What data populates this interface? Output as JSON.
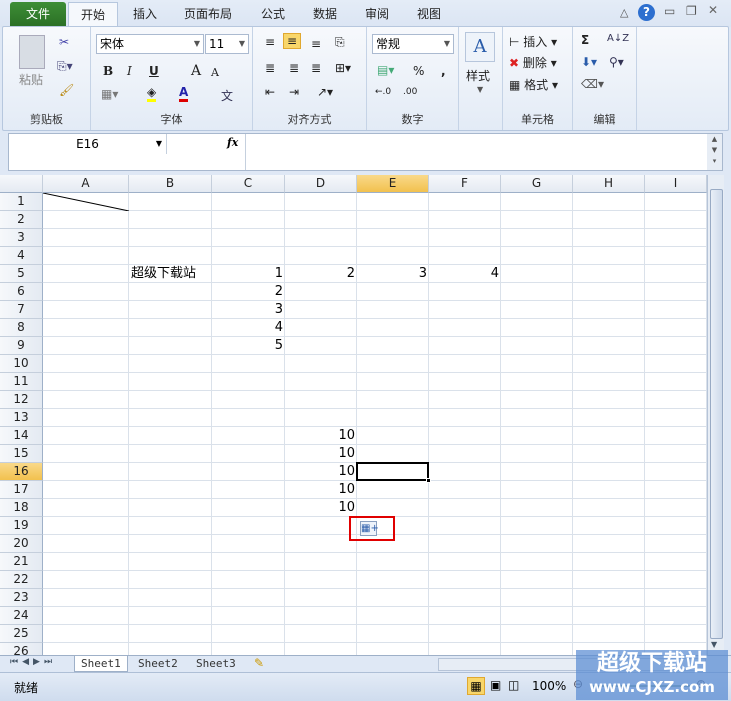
{
  "tabs": [
    "文件",
    "开始",
    "插入",
    "页面布局",
    "公式",
    "数据",
    "审阅",
    "视图"
  ],
  "ribbon": {
    "clipboard": {
      "paste": "粘贴",
      "label": "剪贴板"
    },
    "font": {
      "name": "宋体",
      "size": "11",
      "bold": "B",
      "italic": "I",
      "underline": "U",
      "grow": "A",
      "shrink": "A",
      "color": "A",
      "phonetic": "文",
      "label": "字体"
    },
    "align": {
      "label": "对齐方式"
    },
    "number": {
      "format": "常规",
      "percent": "%",
      "comma": ",",
      "inc": "←.0",
      "dec": ".00",
      "label": "数字"
    },
    "styles": {
      "label": "样式"
    },
    "cells": {
      "insert": "插入",
      "delete": "删除",
      "format": "格式",
      "label": "单元格"
    },
    "edit": {
      "sum": "Σ",
      "sort": "A↓Z",
      "label": "编辑"
    }
  },
  "formula_bar": {
    "name_box": "E16",
    "fx": "fx",
    "value": ""
  },
  "columns": [
    "A",
    "B",
    "C",
    "D",
    "E",
    "F",
    "G",
    "H",
    "I"
  ],
  "active_cell": "E16",
  "cells": [
    {
      "r": 5,
      "c": "B",
      "v": "超级下载站",
      "align": "left"
    },
    {
      "r": 5,
      "c": "C",
      "v": "1"
    },
    {
      "r": 5,
      "c": "D",
      "v": "2"
    },
    {
      "r": 5,
      "c": "E",
      "v": "3"
    },
    {
      "r": 5,
      "c": "F",
      "v": "4"
    },
    {
      "r": 6,
      "c": "C",
      "v": "2"
    },
    {
      "r": 7,
      "c": "C",
      "v": "3"
    },
    {
      "r": 8,
      "c": "C",
      "v": "4"
    },
    {
      "r": 9,
      "c": "C",
      "v": "5"
    },
    {
      "r": 14,
      "c": "D",
      "v": "10"
    },
    {
      "r": 15,
      "c": "D",
      "v": "10"
    },
    {
      "r": 16,
      "c": "D",
      "v": "10"
    },
    {
      "r": 17,
      "c": "D",
      "v": "10"
    },
    {
      "r": 18,
      "c": "D",
      "v": "10"
    }
  ],
  "sheets": [
    "Sheet1",
    "Sheet2",
    "Sheet3"
  ],
  "active_sheet": "Sheet1",
  "status": {
    "ready": "就绪",
    "zoom": "100%"
  },
  "watermark": {
    "line1": "超级下载站",
    "line2": "www.CJXZ.com"
  },
  "colors": {
    "file_tab": "#2f7a2a",
    "accent_highlight": "#f2c14e",
    "paste_box": "#e00000"
  }
}
